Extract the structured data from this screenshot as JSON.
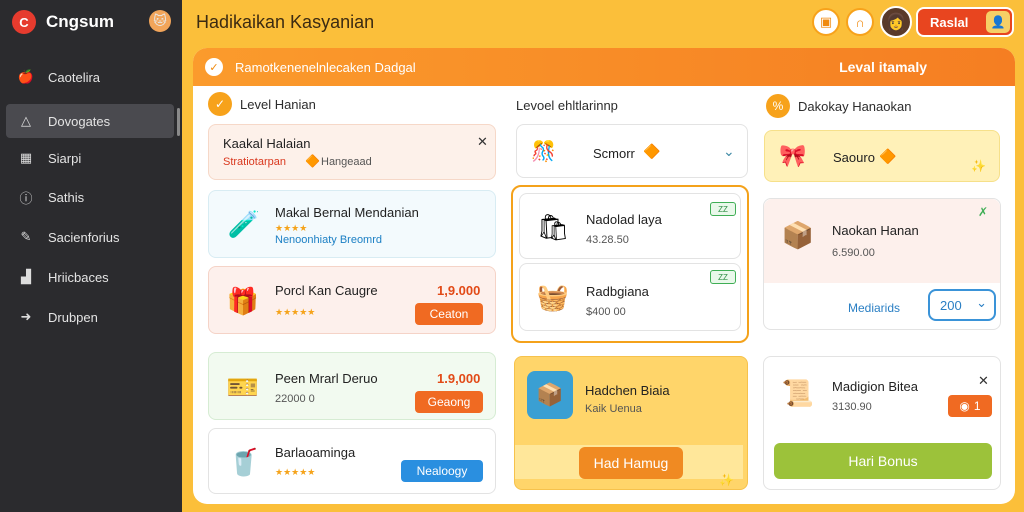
{
  "sidebar": {
    "brand": "Cngsum",
    "items": [
      {
        "label": "Caotelira",
        "icon": "fruit-icon"
      },
      {
        "label": "Dovogates",
        "icon": "triangle-icon"
      },
      {
        "label": "Siarpi",
        "icon": "grid-icon"
      },
      {
        "label": "Sathis",
        "icon": "help-circle-icon"
      },
      {
        "label": "Sacienforius",
        "icon": "edit-icon"
      },
      {
        "label": "Hriicbaces",
        "icon": "chart-icon"
      },
      {
        "label": "Drubpen",
        "icon": "arrow-icon"
      }
    ]
  },
  "header": {
    "title": "Hadikaikan Kasyanian",
    "action_label": "Raslal"
  },
  "banner": {
    "text": "Ramotkenenelnlecaken Dadgal",
    "right": "Leval itamaly"
  },
  "col1": {
    "heading": "Level Hanian",
    "alert": {
      "title": "Kaakal Halaian",
      "sub": "Stratiotarpan",
      "sub2": "Hangeaad"
    },
    "cards": [
      {
        "title": "Makal Bernal Mendanian",
        "sub": "Nenoonhiaty Breomrd",
        "stars": "★★★★"
      },
      {
        "title": "Porcl Kan Caugre",
        "price": "1,9.000",
        "button": "Ceaton",
        "stars": "★★★★★"
      },
      {
        "title": "Peen Mrarl Deruo",
        "sub": "22000 0",
        "price": "1.9,000",
        "button": "Geaong"
      },
      {
        "title": "Barlaoaminga",
        "button": "Nealoogy",
        "stars": "★★★★★"
      }
    ]
  },
  "col2": {
    "heading": "Levoel ehltlarinnp",
    "select": {
      "label": "Scmorr"
    },
    "items": [
      {
        "title": "Nadolad laya",
        "sub": "43.28.50",
        "tag": "ZZ"
      },
      {
        "title": "Radbgiana",
        "sub": "$400 00",
        "tag": "ZZ"
      }
    ],
    "promo": {
      "title": "Hadchen Biaia",
      "sub": "Kaik Uenua",
      "button": "Had Hamug"
    }
  },
  "col3": {
    "heading": "Dakokay Hanaokan",
    "highlight": {
      "title": "Saouro"
    },
    "card": {
      "title": "Naokan Hanan",
      "sub": "6.590.00",
      "field_label": "Mediarids",
      "field_value": "200"
    },
    "bonus": {
      "title": "Madigion Bitea",
      "sub": "3130.90",
      "count": "1",
      "button": "Hari Bonus"
    }
  }
}
